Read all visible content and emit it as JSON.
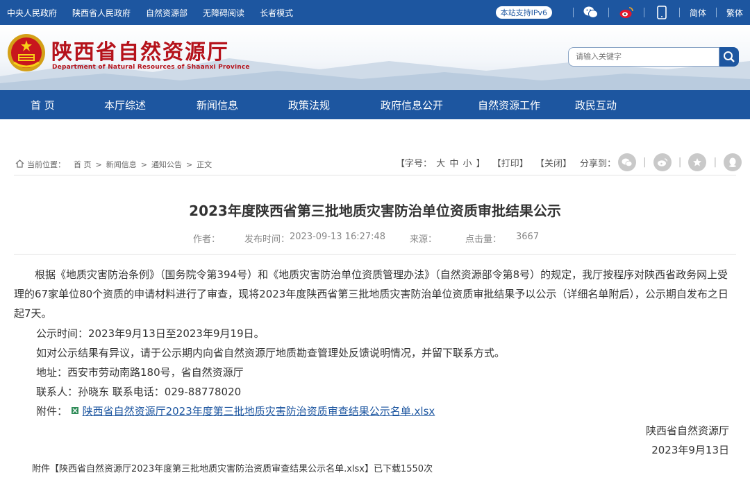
{
  "topbar": {
    "links": [
      "中央人民政府",
      "陕西省人民政府",
      "自然资源部",
      "无障碍阅读",
      "长者模式"
    ],
    "ipv6_badge": "本站支持IPv6",
    "lang_simple": "简体",
    "lang_traditional": "繁体",
    "icons": [
      "wechat-icon",
      "weibo-icon",
      "mobile-icon"
    ]
  },
  "header": {
    "title": "陕西省自然资源厅",
    "subtitle": "Department of Natural Resources of Shaanxi Province",
    "search_placeholder": "请输入关键字"
  },
  "nav": {
    "items": [
      "首 页",
      "本厅综述",
      "新闻信息",
      "政策法规",
      "政府信息公开",
      "自然资源工作",
      "政民互动"
    ]
  },
  "breadcrumb": {
    "label": "当前位置：",
    "items": [
      "首 页",
      "新闻信息",
      "通知公告",
      "正文"
    ],
    "separator": ">"
  },
  "tools": {
    "font_size": "【字号：",
    "big": "大",
    "medium": "中",
    "small": "小",
    "font_close": "】",
    "print": "【打印】",
    "close": "【关闭】",
    "share_label": "分享到：",
    "share_icons": [
      "wechat-icon",
      "weibo-icon",
      "star-icon",
      "qq-icon"
    ]
  },
  "article": {
    "title": "2023年度陕西省第三批地质灾害防治单位资质审批结果公示",
    "author_label": "作者：",
    "publish_label": "发布时间：",
    "publish_time": "2023-09-13 16:27:48",
    "source_label": "来源：",
    "hits_label": "点击量：",
    "hits": "3667",
    "paragraph": "根据《地质灾害防治条例》（国务院令第394号）和《地质灾害防治单位资质管理办法》（自然资源部令第8号）的规定，我厅按程序对陕西省政务网上受理的67家单位80个资质的申请材料进行了审查，现将2023年度陕西省第三批地质灾害防治单位资质审批结果予以公示（详细名单附后），公示期自发布之日起7天。",
    "period": "公示时间：2023年9月13日至2023年9月19日。",
    "objection": "如对公示结果有异议，请于公示期内向省自然资源厅地质勘查管理处反馈说明情况，并留下联系方式。",
    "address": "地址：西安市劳动南路180号，省自然资源厅",
    "contact": "联系人：孙晓东 联系电话：029-88778020",
    "attachment_label": "附件：",
    "attachment_name": "陕西省自然资源厅2023年度第三批地质灾害防治资质审查结果公示名单.xlsx",
    "sign_org": "陕西省自然资源厅",
    "sign_date": "2023年9月13日",
    "footnote": "附件【陕西省自然资源厅2023年度第三批地质灾害防治资质审查结果公示名单.xlsx】已下载1550次"
  },
  "colors": {
    "brand_blue": "#1d56a0",
    "title_red": "#b5121b"
  }
}
